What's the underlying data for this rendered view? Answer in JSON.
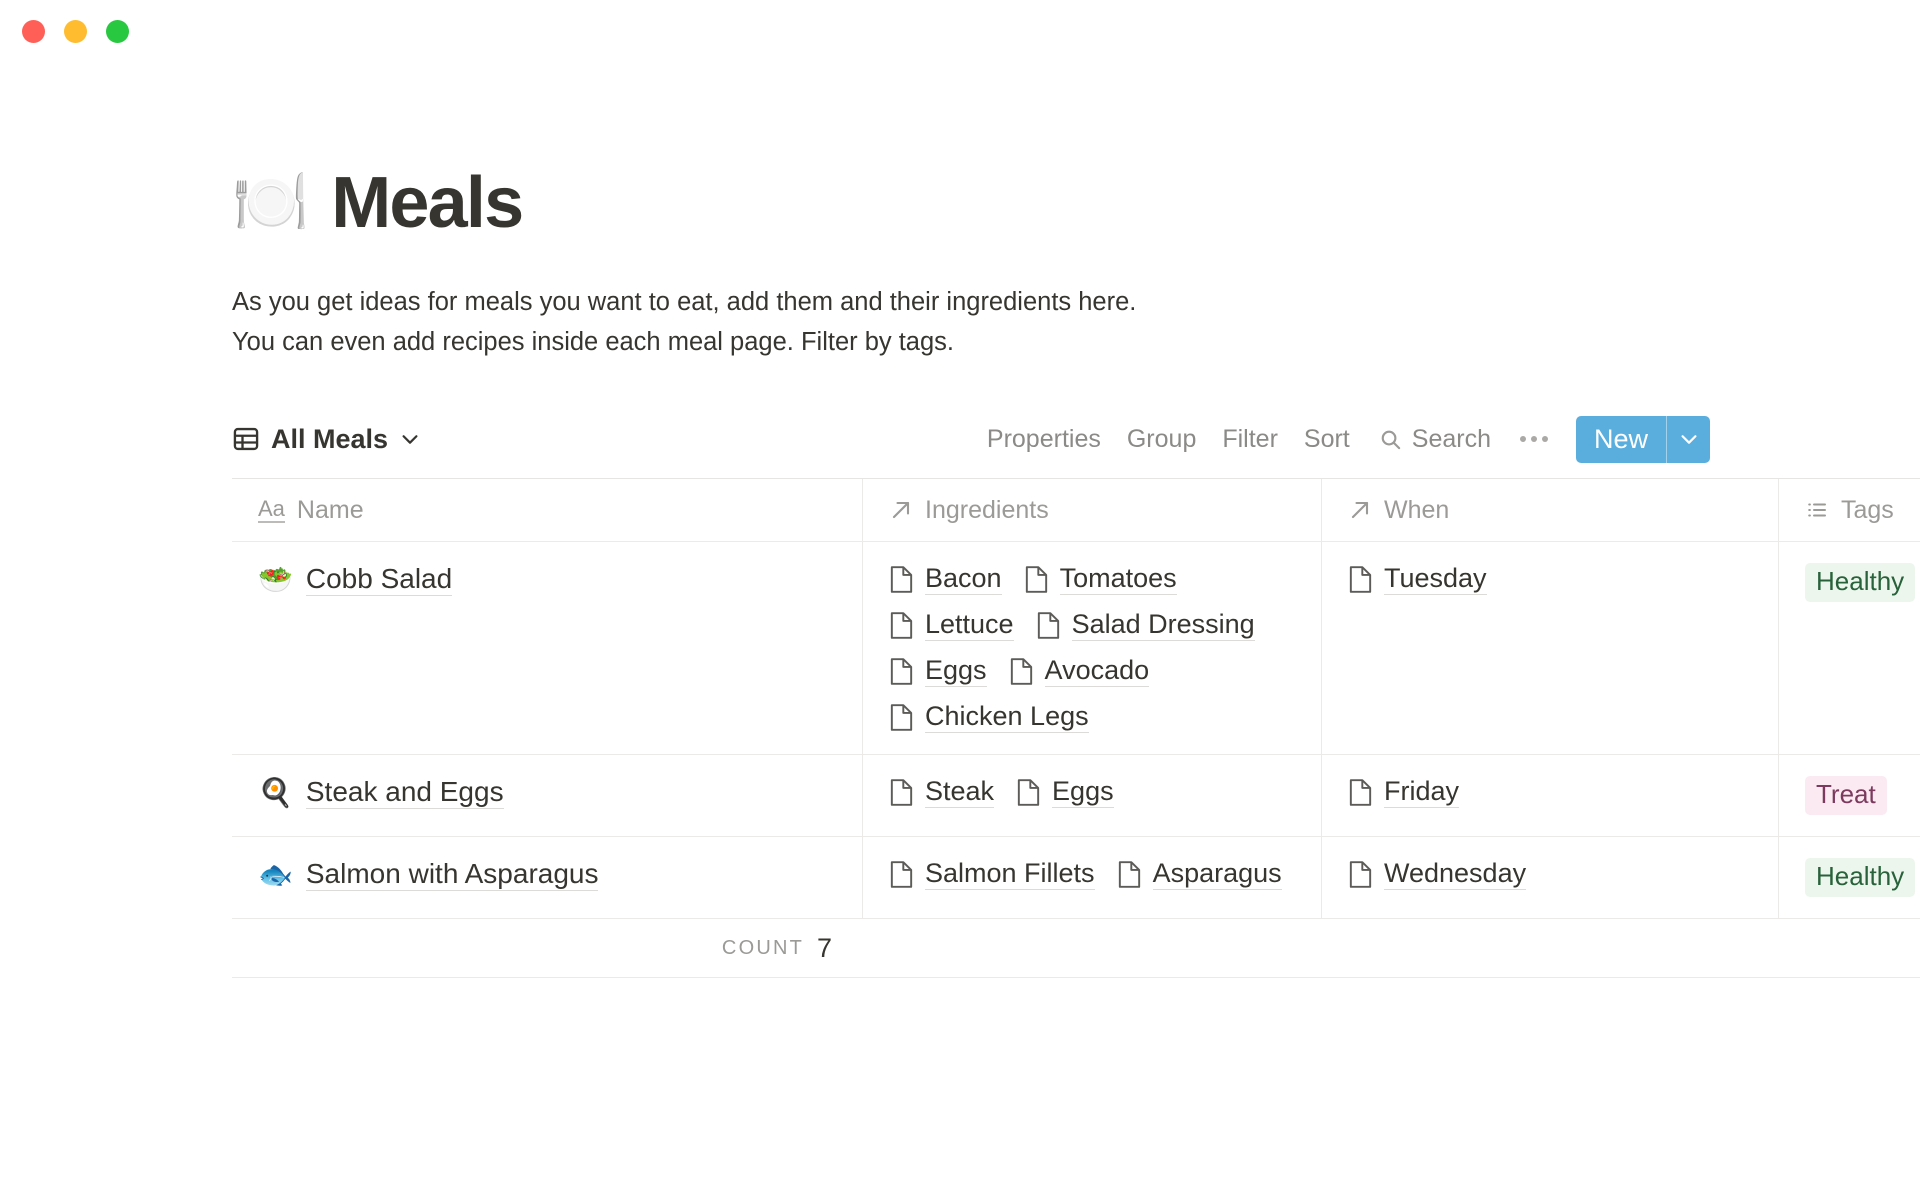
{
  "window": {
    "controls": [
      {
        "name": "close",
        "color": "#ff5f57"
      },
      {
        "name": "minimize",
        "color": "#febc2e"
      },
      {
        "name": "zoom",
        "color": "#28c840"
      }
    ]
  },
  "header": {
    "emoji": "🍽️",
    "title": "Meals",
    "description_line_1": "As you get ideas for meals you want to eat, add them and their ingredients here.",
    "description_line_2": "You can even add recipes inside each meal page. Filter by tags."
  },
  "toolbar": {
    "view_icon": "table-grid-icon",
    "view_name": "All Meals",
    "view_chevron": "chevron-down-icon",
    "properties_label": "Properties",
    "group_label": "Group",
    "filter_label": "Filter",
    "sort_label": "Sort",
    "search_icon": "search-icon",
    "search_label": "Search",
    "more_icon": "ellipsis-icon",
    "new_label": "New",
    "new_chevron": "chevron-down-icon",
    "new_button_color": "#5aaede"
  },
  "table": {
    "columns": [
      {
        "label": "Name",
        "icon": "title-aa-icon"
      },
      {
        "label": "Ingredients",
        "icon": "relation-arrow-icon"
      },
      {
        "label": "When",
        "icon": "relation-arrow-icon"
      },
      {
        "label": "Tags",
        "icon": "multi-select-list-icon"
      }
    ],
    "rows": [
      {
        "emoji": "🥗",
        "name": "Cobb Salad",
        "ingredients": [
          "Bacon",
          "Tomatoes",
          "Lettuce",
          "Salad Dressing",
          "Eggs",
          "Avocado",
          "Chicken Legs"
        ],
        "when": [
          "Tuesday"
        ],
        "tags": [
          {
            "label": "Healthy",
            "style": "green"
          }
        ]
      },
      {
        "emoji": "🍳",
        "name": "Steak and Eggs",
        "ingredients": [
          "Steak",
          "Eggs"
        ],
        "when": [
          "Friday"
        ],
        "tags": [
          {
            "label": "Treat",
            "style": "pink"
          }
        ]
      },
      {
        "emoji": "🐟",
        "name": "Salmon with Asparagus",
        "ingredients": [
          "Salmon Fillets",
          "Asparagus"
        ],
        "when": [
          "Wednesday"
        ],
        "tags": [
          {
            "label": "Healthy",
            "style": "green"
          }
        ]
      }
    ]
  },
  "footer": {
    "count_label": "Count",
    "count_value": "7"
  },
  "colors": {
    "tag_green_bg": "#edf6ed",
    "tag_green_fg": "#28623a",
    "tag_pink_bg": "#fbeaf2",
    "tag_pink_fg": "#7c3a5f",
    "text": "#37352f",
    "muted": "#9b9a97"
  }
}
